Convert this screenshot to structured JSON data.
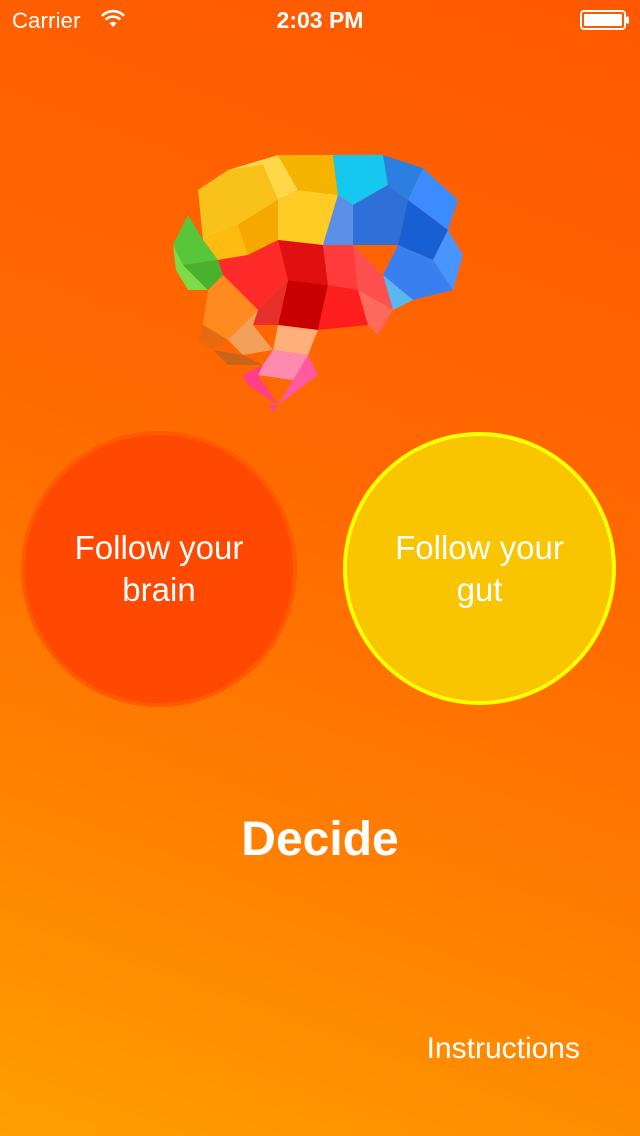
{
  "status_bar": {
    "carrier": "Carrier",
    "time": "2:03 PM",
    "wifi_icon": "wifi-icon",
    "battery_icon": "battery-full-icon"
  },
  "logo": {
    "icon": "polygonal-brain-icon"
  },
  "choices": {
    "brain_label": "Follow your brain",
    "gut_label": "Follow your gut",
    "brain_color": "#ff4800",
    "gut_color": "#f9c400",
    "gut_border_color": "#ffff00"
  },
  "title": "Decide",
  "instructions_label": "Instructions",
  "colors": {
    "background_top": "#ff5800",
    "background_bottom": "#ff9f00",
    "text": "#ffffff"
  }
}
